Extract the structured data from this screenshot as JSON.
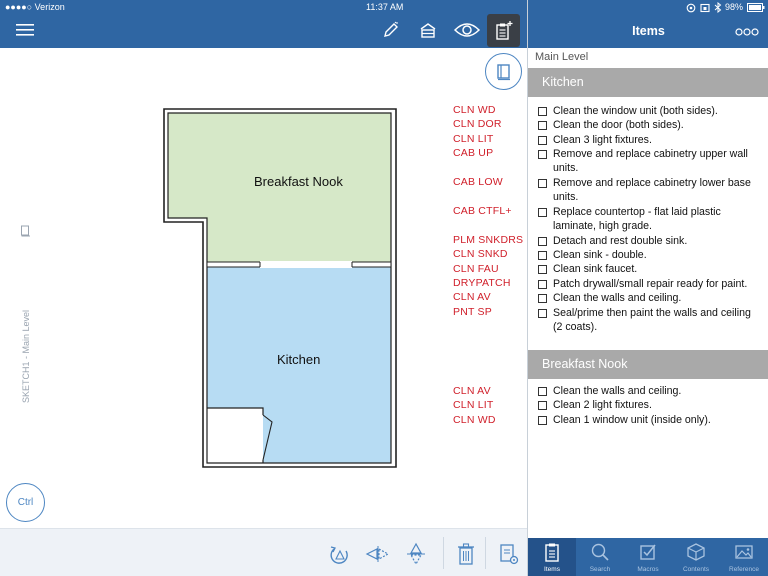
{
  "status": {
    "carrier": "●●●●○ Verizon",
    "time": "11:37 AM",
    "battery": "98%"
  },
  "toolbar": {
    "icons": [
      "menu-icon",
      "pencil-icon",
      "level-icon",
      "eye-icon",
      "clipboard-add-icon"
    ]
  },
  "canvas": {
    "side_label": "SKETCH1 - Main Level",
    "rooms": [
      {
        "label": "Breakfast Nook",
        "fill": "#d6e8c8"
      },
      {
        "label": "Kitchen",
        "fill": "#b7dcf3"
      }
    ],
    "codes_kitchen": [
      "CLN WD",
      "CLN DOR",
      "CLN LIT",
      "CAB UP",
      "CAB LOW",
      "CAB CTFL+",
      "PLM SNKDRS",
      "CLN SNKD",
      "CLN FAU",
      "DRYPATCH",
      "CLN AV",
      "PNT SP"
    ],
    "codes_nook": [
      "CLN AV",
      "CLN LIT",
      "CLN WD"
    ],
    "ctrl_label": "Ctrl"
  },
  "bottom_toolbar": {
    "icons": [
      "rotate-icon",
      "flip-horizontal-icon",
      "flip-vertical-icon",
      "trash-icon",
      "settings-doc-icon"
    ]
  },
  "panel": {
    "title": "Items",
    "more_label": "ooo",
    "level": "Main Level",
    "sections": [
      {
        "name": "Kitchen",
        "items": [
          "Clean the window unit (both sides).",
          "Clean the door (both sides).",
          "Clean 3 light fixtures.",
          "Remove and replace cabinetry upper wall units.",
          "Remove and replace cabinetry lower base units.",
          "Replace countertop - flat laid plastic laminate, high grade.",
          "Detach and rest double sink.",
          "Clean sink - double.",
          "Clean sink faucet.",
          "Patch drywall/small repair ready for paint.",
          "Clean the walls and ceiling.",
          "Seal/prime then paint the walls and ceiling (2 coats)."
        ]
      },
      {
        "name": "Breakfast Nook",
        "items": [
          "Clean the walls and ceiling.",
          "Clean 2 light fixtures.",
          "Clean 1 window unit (inside only)."
        ]
      }
    ],
    "tabs": [
      {
        "label": "Items",
        "icon": "clipboard-icon"
      },
      {
        "label": "Search",
        "icon": "search-icon"
      },
      {
        "label": "Macros",
        "icon": "checkbox-icon"
      },
      {
        "label": "Contents",
        "icon": "box-icon"
      },
      {
        "label": "Reference",
        "icon": "image-icon"
      }
    ]
  },
  "colors": {
    "header_blue": "#2f66a3",
    "code_red": "#d0202b",
    "section_gray": "#a9a9a9"
  }
}
